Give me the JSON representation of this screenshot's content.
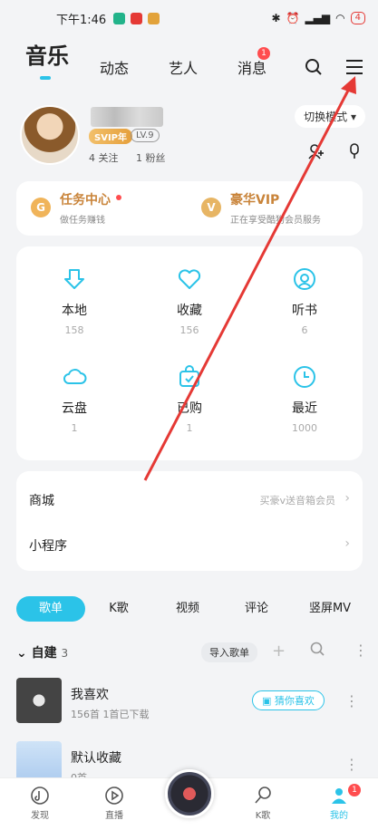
{
  "status": {
    "time": "下午1:46",
    "battery": "4"
  },
  "nav": {
    "tabs": [
      "音乐",
      "动态",
      "艺人",
      "消息"
    ],
    "message_badge": "1"
  },
  "profile": {
    "svip": "SVIP年",
    "level": "LV.9",
    "follow_count": "4",
    "follow_label": "关注",
    "fans_count": "1",
    "fans_label": "粉丝",
    "mode_button": "切换模式"
  },
  "vip_card": {
    "task_title": "任务中心",
    "task_sub": "做任务赚钱",
    "vip_title": "豪华VIP",
    "vip_sub": "正在享受酷狗会员服务",
    "task_icon": "G",
    "vip_icon": "V"
  },
  "grid": [
    {
      "label": "本地",
      "count": "158",
      "icon": "download-icon"
    },
    {
      "label": "收藏",
      "count": "156",
      "icon": "heart-icon"
    },
    {
      "label": "听书",
      "count": "6",
      "icon": "headphone-icon"
    },
    {
      "label": "云盘",
      "count": "1",
      "icon": "cloud-icon"
    },
    {
      "label": "已购",
      "count": "1",
      "icon": "bag-icon"
    },
    {
      "label": "最近",
      "count": "1000",
      "icon": "clock-icon"
    }
  ],
  "list": [
    {
      "title": "商城",
      "hint": "买豪v送音箱会员"
    },
    {
      "title": "小程序",
      "hint": ""
    }
  ],
  "seg_tabs": [
    "歌单",
    "K歌",
    "视频",
    "评论",
    "竖屏MV"
  ],
  "self_built": {
    "title": "自建",
    "count": "3",
    "import_label": "导入歌单"
  },
  "playlists": [
    {
      "title": "我喜欢",
      "meta": "156首  1首已下载",
      "button": "猜你喜欢"
    },
    {
      "title": "默认收藏",
      "meta": "0首"
    }
  ],
  "bottom": {
    "tabs": [
      "发现",
      "直播",
      "K歌",
      "我的"
    ],
    "me_badge": "1"
  },
  "colors": {
    "accent": "#2bc3e8",
    "badge": "#ff4d4f",
    "vip": "#c9843a",
    "arrow": "#e53935"
  }
}
